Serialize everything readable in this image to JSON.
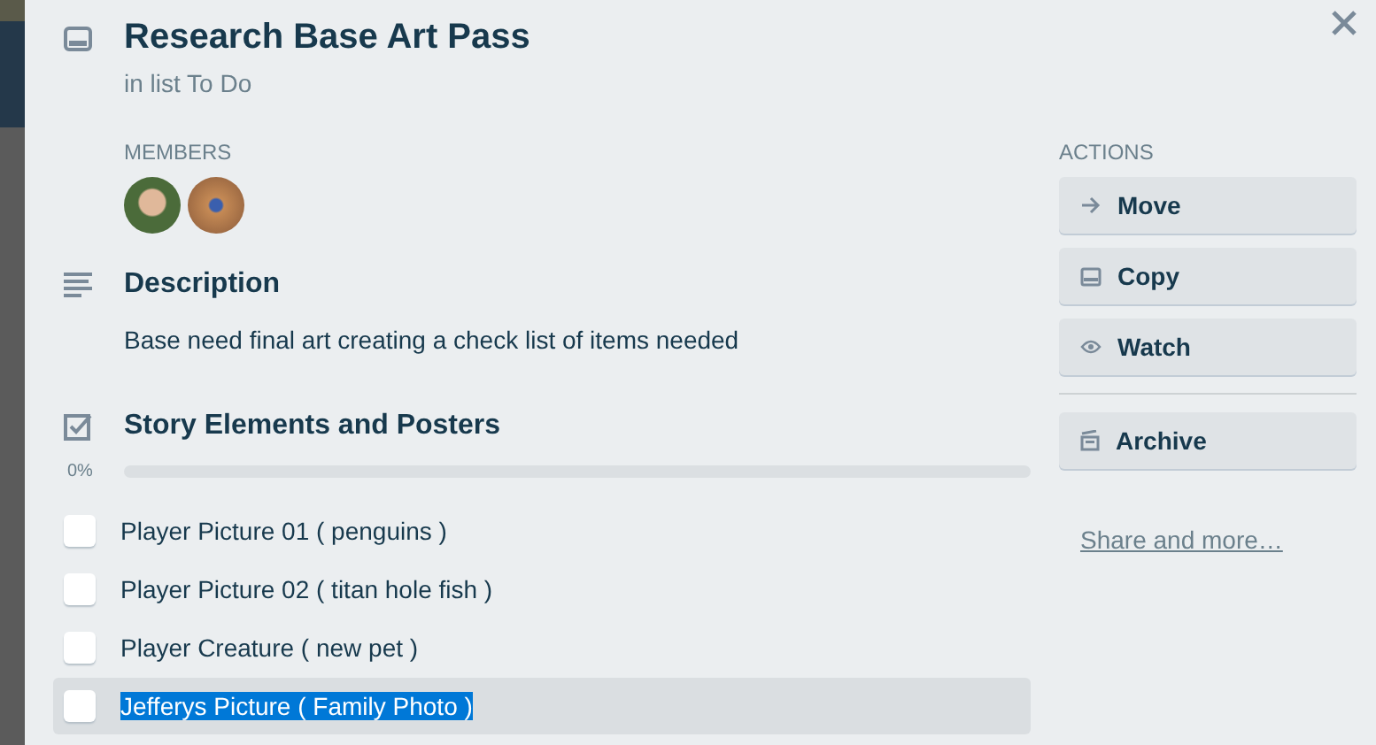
{
  "card": {
    "title": "Research Base Art Pass",
    "list_info": "in list To Do"
  },
  "members": {
    "label": "MEMBERS",
    "avatars": [
      {
        "kind": "photo"
      },
      {
        "kind": "photo"
      }
    ]
  },
  "description": {
    "heading": "Description",
    "text": "Base need final art creating a check list of items needed"
  },
  "checklist": {
    "heading": "Story Elements and Posters",
    "percent": "0%",
    "level": 0,
    "items": [
      {
        "label": "Player Picture 01 ( penguins )",
        "checked": false,
        "selected": false
      },
      {
        "label": "Player Picture 02 ( titan hole fish )",
        "checked": false,
        "selected": false
      },
      {
        "label": "Player Creature ( new pet )",
        "checked": false,
        "selected": false
      },
      {
        "label": "Jefferys Picture ( Family Photo )",
        "checked": false,
        "selected": true
      }
    ]
  },
  "actions": {
    "label": "ACTIONS",
    "groups": [
      [
        {
          "label": "Move",
          "kind": "move"
        },
        {
          "label": "Copy",
          "kind": "copy"
        },
        {
          "label": "Watch",
          "kind": "watch"
        }
      ],
      [
        {
          "label": "Archive",
          "kind": "archive"
        }
      ]
    ],
    "share_link": "Share and more…"
  }
}
